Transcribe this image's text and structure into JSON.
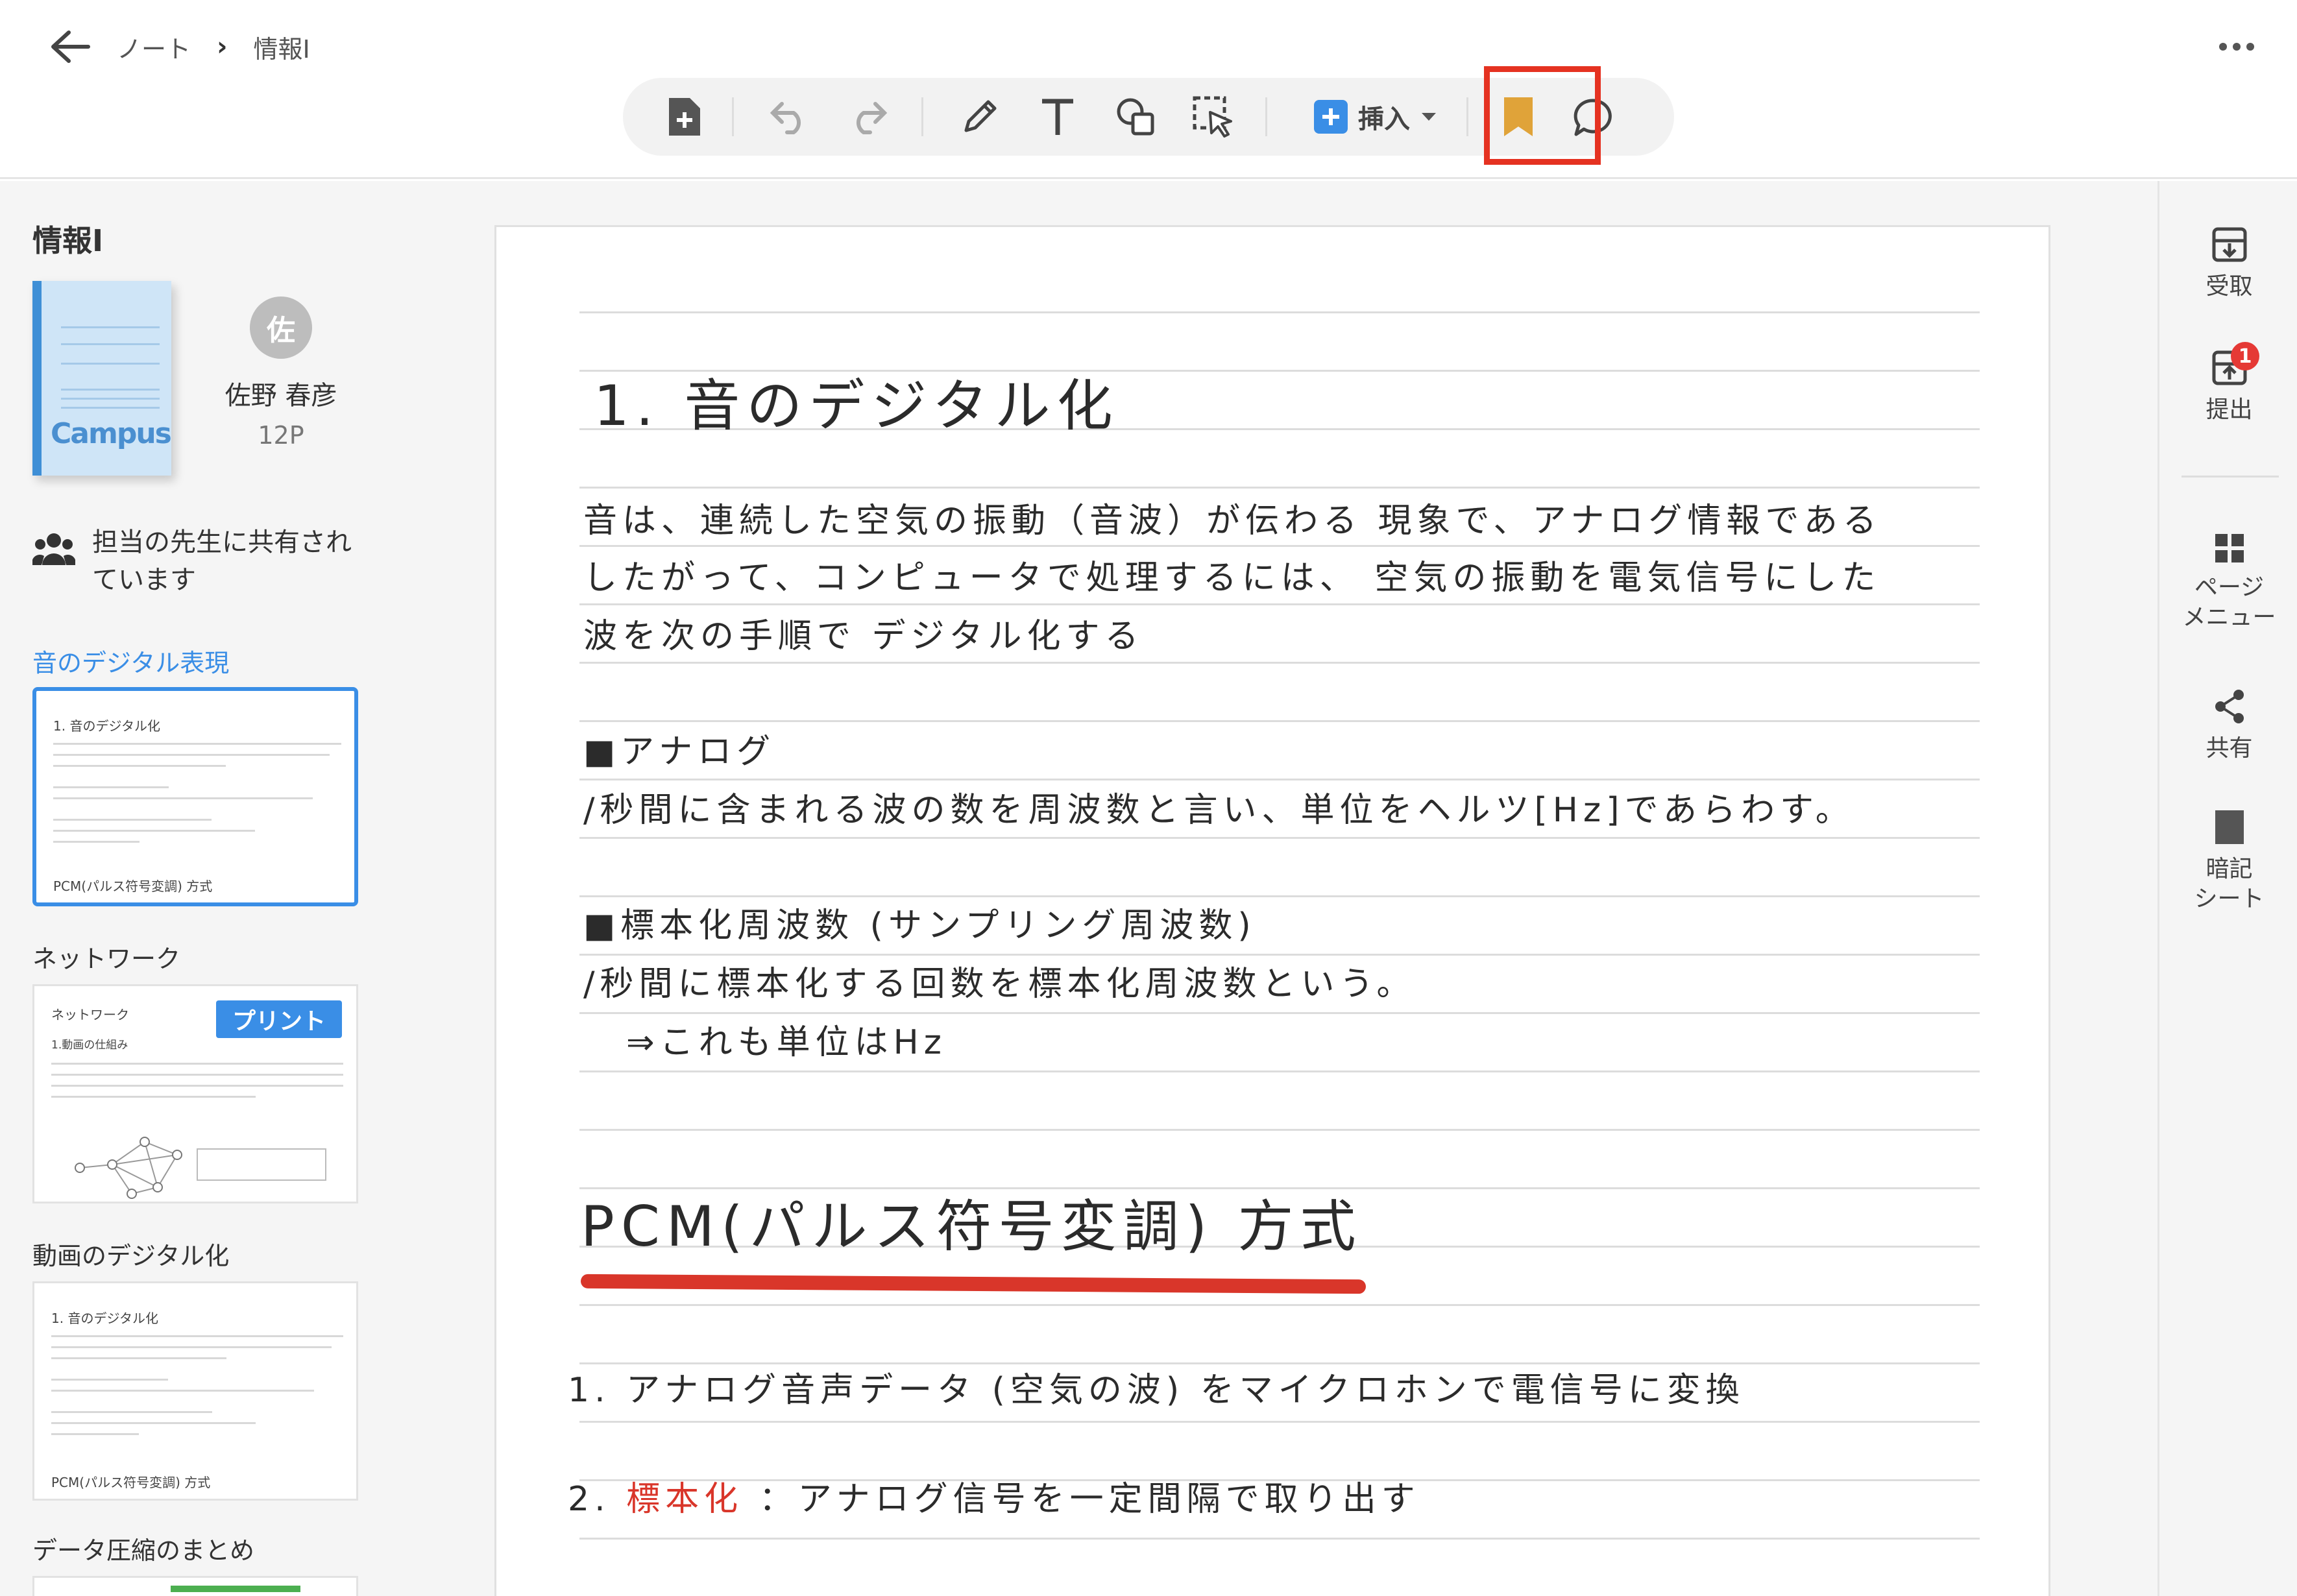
{
  "header": {
    "breadcrumb": [
      "ノート",
      "情報I"
    ],
    "breadcrumb_sep": "›"
  },
  "toolbar": {
    "insert_label": "挿入",
    "highlight_color": "#e53221",
    "bookmark_color": "#e0a339",
    "insert_color": "#3a8ee6"
  },
  "sidebar": {
    "notebook_title": "情報I",
    "cover_brand": "Campus",
    "avatar_initial": "佐",
    "owner_name": "佐野 春彦",
    "page_count": "12P",
    "share_note": "担当の先生に共有されています",
    "sections": [
      {
        "label": "音のデジタル表現",
        "active": true
      },
      {
        "label": "ネットワーク",
        "active": false
      },
      {
        "label": "動画のデジタル化",
        "active": false
      },
      {
        "label": "データ圧縮のまとめ",
        "active": false
      }
    ],
    "thumb1": {
      "title": "1. 音のデジタル化",
      "footer": "PCM(パルス符号変調) 方式"
    },
    "thumb2": {
      "title": "ネットワーク",
      "subtitle": "1.動画の仕組み",
      "badge": "プリント"
    },
    "thumb3": {
      "title": "1. 音のデジタル化",
      "footer": "PCM(パルス符号変調) 方式"
    }
  },
  "note": {
    "heading1": "1. 音のデジタル化",
    "para1": [
      "音は、連続した空気の振動（音波）が伝わる 現象で、アナログ情報である",
      "したがって、コンピュータで処理するには、 空気の振動を電気信号にした",
      "波を次の手順で デジタル化する"
    ],
    "analog_title": "■アナログ",
    "analog_body": "/秒間に含まれる波の数を周波数と言い、単位をヘルツ[Hz]であらわす。",
    "sampling_title": "■標本化周波数 (サンプリング周波数)",
    "sampling_body": "/秒間に標本化する回数を標本化周波数という。",
    "sampling_note": "⇒これも単位はHz",
    "heading2": "PCM(パルス符号変調) 方式",
    "step1": "1. アナログ音声データ (空気の波) をマイクロホンで電信号に変換",
    "step2_num": "2.",
    "step2_red": "標本化",
    "step2_rest": "：アナログ信号を一定間隔で取り出す"
  },
  "right_panel": {
    "receive": "受取",
    "submit": "提出",
    "submit_badge": "1",
    "page_menu": [
      "ページ",
      "メニュー"
    ],
    "share": "共有",
    "memo_sheet": [
      "暗記",
      "シート"
    ]
  }
}
